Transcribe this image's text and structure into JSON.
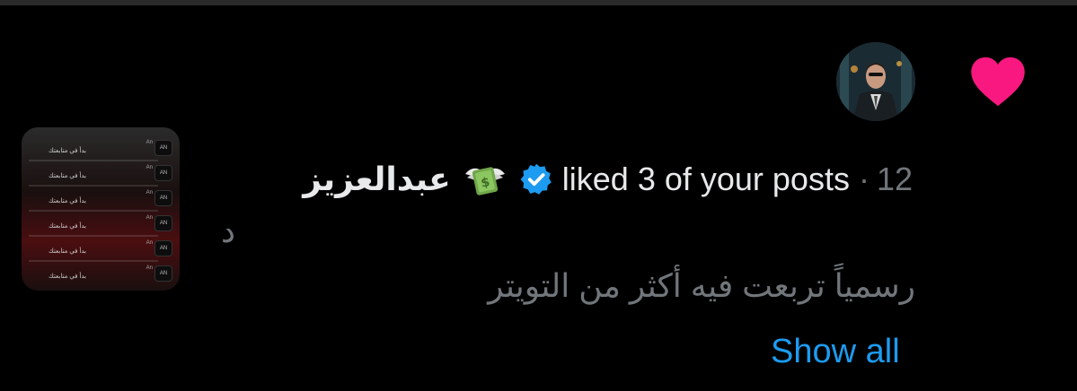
{
  "notification": {
    "user_name": "عبدالعزيز",
    "liked_text": "liked 3 of your posts",
    "separator": "·",
    "time_number": "12",
    "time_unit": "د",
    "post_preview": "رسمياً تربعت فيه أكثر من التويتر",
    "show_all_label": "Show all",
    "heart_color": "#f91880",
    "verified_color": "#1d9bf0",
    "link_color": "#1d9bf0",
    "icons": {
      "heart": "heart-icon",
      "verified": "verified-badge-icon",
      "money": "money-with-wings-icon"
    }
  },
  "thumbnail": {
    "rows": [
      {
        "tag": "An",
        "pill": "AN",
        "snippet": "بدأ في متابعتك"
      },
      {
        "tag": "An",
        "pill": "AN",
        "snippet": "بدأ في متابعتك"
      },
      {
        "tag": "An",
        "pill": "AN",
        "snippet": "بدأ في متابعتك"
      },
      {
        "tag": "An",
        "pill": "AN",
        "snippet": "بدأ في متابعتك"
      },
      {
        "tag": "An",
        "pill": "AN",
        "snippet": "بدأ في متابعتك"
      },
      {
        "tag": "An",
        "pill": "AN",
        "snippet": "بدأ في متابعتك"
      }
    ]
  }
}
